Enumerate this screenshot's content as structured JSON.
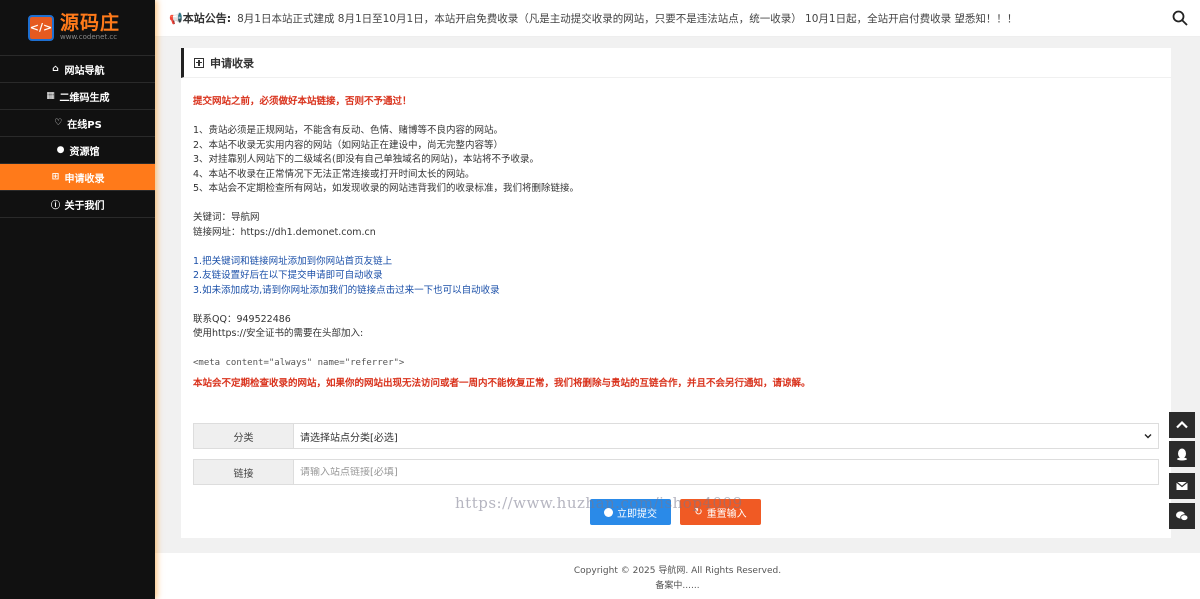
{
  "brand": {
    "title": "源码庄",
    "subtitle": "www.codenet.cc",
    "mark": "</>"
  },
  "sidebar": {
    "items": [
      {
        "label": "网站导航",
        "icon": "home-icon",
        "glyph": "⌂"
      },
      {
        "label": "二维码生成",
        "icon": "qrcode-icon",
        "glyph": "▦"
      },
      {
        "label": "在线PS",
        "icon": "heart-icon",
        "glyph": "♡"
      },
      {
        "label": "资源馆",
        "icon": "github-icon",
        "glyph": "●"
      },
      {
        "label": "申请收录",
        "icon": "plus-square-icon",
        "glyph": "⊞"
      },
      {
        "label": "关于我们",
        "icon": "info-icon",
        "glyph": "ⓘ"
      }
    ],
    "active_index": 4
  },
  "topbar": {
    "notice_label": "本站公告:",
    "notice_text": "8月1日本站正式建成 8月1日至10月1日，本站开启免费收录（凡是主动提交收录的网站，只要不是违法站点，统一收录） 10月1日起，全站开启付费收录 望悉知！！！"
  },
  "panel": {
    "title": "申请收录",
    "warning_top": "提交网站之前，必须做好本站链接，否则不予通过！",
    "rules": [
      "1、贵站必须是正规网站，不能含有反动、色情、赌博等不良内容的网站。",
      "2、本站不收录无实用内容的网站（如网站正在建设中，尚无完整内容等）",
      "3、对挂靠别人网站下的二级域名(即没有自己单独域名的网站)，本站将不予收录。",
      "4、本站不收录在正常情况下无法正常连接或打开时间太长的网站。",
      "5、本站会不定期检查所有网站，如发现收录的网站违背我们的收录标准，我们将删除链接。"
    ],
    "keyword_line": "关键词：导航网",
    "link_line": "链接网址：https://dh1.demonet.com.cn",
    "steps": [
      "1.把关键词和链接网址添加到你网站首页友链上",
      "2.友链设置好后在以下提交申请即可自动收录",
      "3.如未添加成功,请到你网址添加我们的链接点击过来一下也可以自动收录"
    ],
    "qq_line": "联系QQ：949522486",
    "https_line": "使用https://安全证书的需要在头部加入:",
    "meta_code": "<meta content=\"always\" name=\"referrer\">",
    "warning_bottom": "本站会不定期检查收录的网站，如果你的网站出现无法访问或者一周内不能恢复正常，我们将删除与贵站的互链合作，并且不会另行通知，请谅解。"
  },
  "form": {
    "category_label": "分类",
    "category_value": "请选择站点分类[必选]",
    "link_label": "链接",
    "link_placeholder": "请输入站点链接[必填]",
    "submit_label": "立即提交",
    "reset_label": "重置输入"
  },
  "watermark": "https://www.huzhan.com/ishop4009",
  "footer": {
    "copyright": "Copyright © 2025 导航网. All Rights Reserved.",
    "icp": "备案中......"
  },
  "colors": {
    "accent": "#ff7a1a",
    "sidebar_bg": "#111111",
    "warning": "#d9321c",
    "link_blue": "#1a4fa8",
    "submit": "#2a8ae8",
    "reset": "#f05a24"
  }
}
